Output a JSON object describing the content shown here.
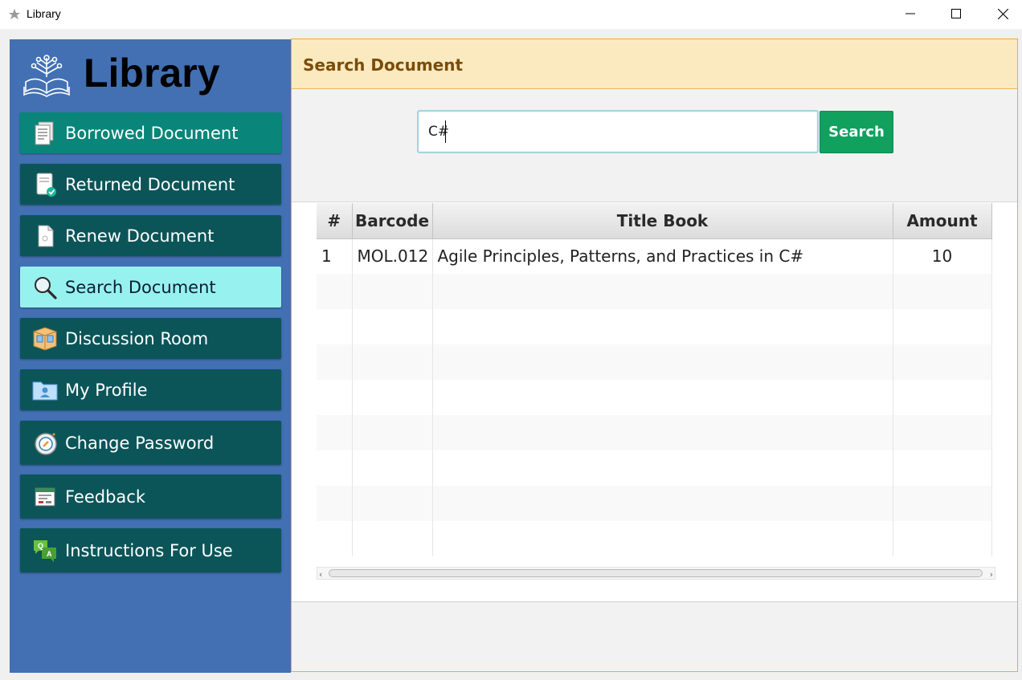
{
  "window": {
    "title": "Library",
    "controls": [
      "minimize-icon",
      "maximize-icon",
      "close-icon"
    ]
  },
  "sidebar": {
    "brand": "Library",
    "items": [
      {
        "label": "Borrowed Document",
        "icon": "document-pages-icon"
      },
      {
        "label": "Returned Document",
        "icon": "document-check-icon"
      },
      {
        "label": "Renew Document",
        "icon": "document-icon"
      },
      {
        "label": "Search Document",
        "icon": "magnifier-icon",
        "active": true
      },
      {
        "label": "Discussion Room",
        "icon": "room-icon"
      },
      {
        "label": "My Profile",
        "icon": "profile-folder-icon"
      },
      {
        "label": "Change Password",
        "icon": "password-icon"
      },
      {
        "label": "Feedback",
        "icon": "feedback-form-icon"
      },
      {
        "label": "Instructions For Use",
        "icon": "qa-chat-icon"
      }
    ]
  },
  "main": {
    "title": "Search Document",
    "search": {
      "value": "C#",
      "button_label": "Search"
    },
    "table": {
      "columns": [
        "#",
        "Barcode",
        "Title Book",
        "Amount"
      ],
      "rows": [
        {
          "index": "1",
          "barcode": "MOL.012",
          "title": "Agile Principles, Patterns, and Practices in C#",
          "amount": "10"
        }
      ]
    }
  },
  "colors": {
    "sidebar": "#4270b3",
    "nav_item": "#0b5559",
    "nav_borrowed": "#0a8579",
    "nav_active": "#97f1ef",
    "header_bg": "#fbe9bf",
    "header_text": "#7a4d0a",
    "search_button": "#12a05f"
  }
}
